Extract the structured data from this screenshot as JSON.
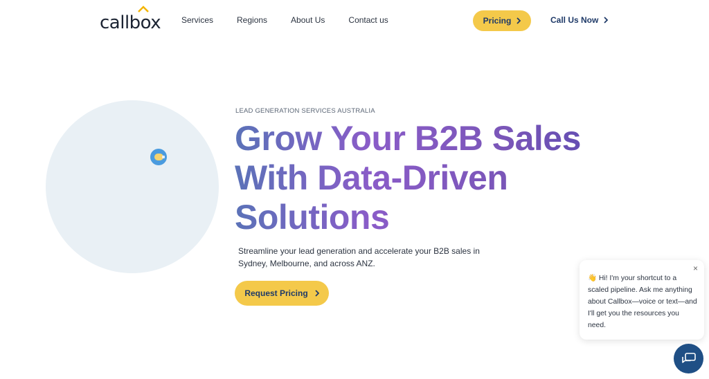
{
  "header": {
    "logo_text": "callbox",
    "nav": [
      {
        "label": "Services"
      },
      {
        "label": "Regions"
      },
      {
        "label": "About Us"
      },
      {
        "label": "Contact us"
      }
    ],
    "pricing_label": "Pricing",
    "call_label": "Call Us Now"
  },
  "hero": {
    "eyebrow": "LEAD GENERATION SERVICES AUSTRALIA",
    "headline": "Grow Your B2B Sales With Data-Driven Solutions",
    "subcopy": "Streamline your lead generation and accelerate your B2B sales in Sydney, Melbourne, and across ANZ.",
    "cta_label": "Request Pricing"
  },
  "chat": {
    "message": "👋 Hi! I'm your shortcut to a scaled pipeline. Ask me anything about Callbox—voice or text—and I'll get you the resources you need.",
    "close": "×"
  },
  "colors": {
    "accent_yellow": "#f4c94a",
    "navy": "#1f3a68",
    "chat_launcher": "#1f4f85",
    "illustration_bg": "#e9f0f5"
  },
  "icons": {
    "logo_roof": "caret-up-icon",
    "chevron": "chevron-right-icon",
    "bulb": "lightbulb-icon",
    "chat": "chat-bubbles-icon"
  }
}
